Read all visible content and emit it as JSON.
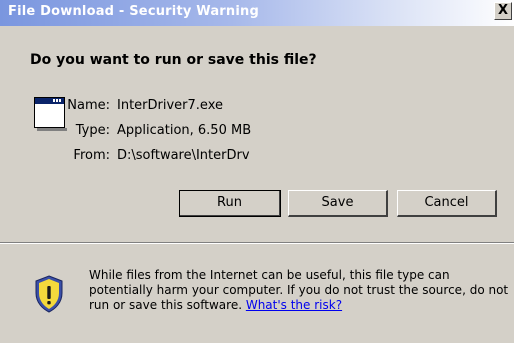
{
  "window": {
    "title": "File Download - Security Warning",
    "close_label": "X"
  },
  "question": "Do you want to run or save this file?",
  "file_info": {
    "name_label": "Name:",
    "name_value": "InterDriver7.exe",
    "type_label": "Type:",
    "type_value": "Application, 6.50 MB",
    "from_label": "From:",
    "from_value": "D:\\software\\InterDrv"
  },
  "buttons": {
    "run": "Run",
    "save": "Save",
    "cancel": "Cancel"
  },
  "warning": {
    "text": "While files from the Internet can be useful, this file type can potentially harm your computer. If you do not trust the source, do not run or save this software. ",
    "link": "What's the risk?"
  },
  "icons": {
    "file": "application-window-icon",
    "warning": "security-shield-icon"
  },
  "colors": {
    "dialog_bg": "#d4d0c8",
    "titlebar_start": "#7a96df",
    "link": "#0000ee",
    "shield_yellow": "#f4d93c",
    "shield_blue": "#3a4fa8"
  }
}
